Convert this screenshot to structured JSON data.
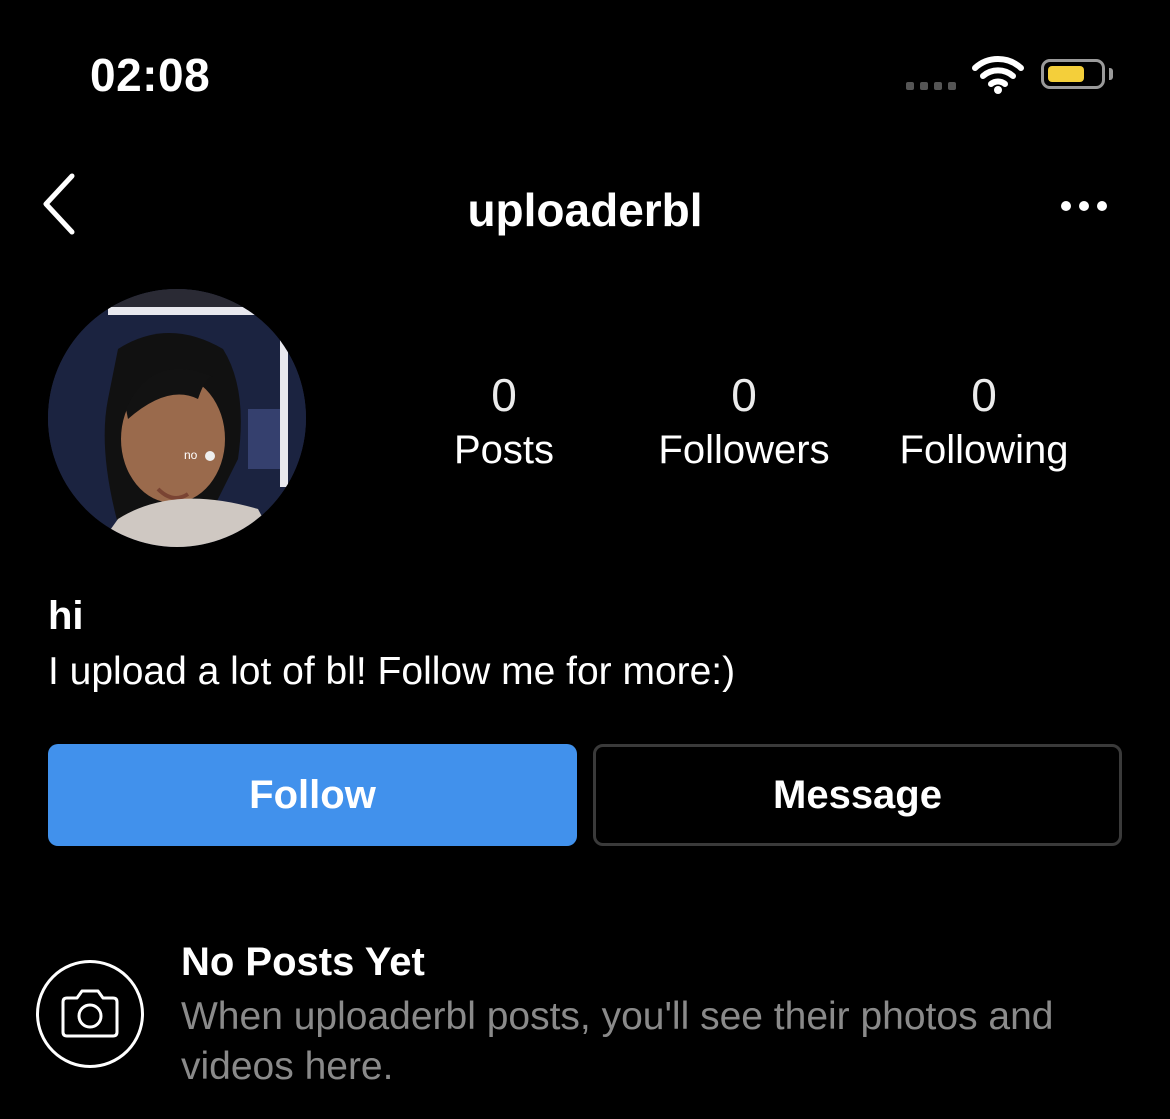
{
  "status_bar": {
    "time": "02:08",
    "battery_color": "#f4cf3a"
  },
  "nav": {
    "back_icon": "chevron-left-icon",
    "username": "uploaderbl",
    "more_icon": "ellipsis-icon"
  },
  "profile": {
    "avatar_overlay_text": "no",
    "stats": [
      {
        "value": "0",
        "label": "Posts"
      },
      {
        "value": "0",
        "label": "Followers"
      },
      {
        "value": "0",
        "label": "Following"
      }
    ],
    "bio_name": "hi",
    "bio_text": "I upload a lot of bl! Follow me for more:)"
  },
  "actions": {
    "follow_label": "Follow",
    "message_label": "Message",
    "follow_color": "#4191ec"
  },
  "empty_state": {
    "icon": "camera-icon",
    "title": "No Posts Yet",
    "description": "When uploaderbl posts, you'll see their photos and videos here."
  }
}
